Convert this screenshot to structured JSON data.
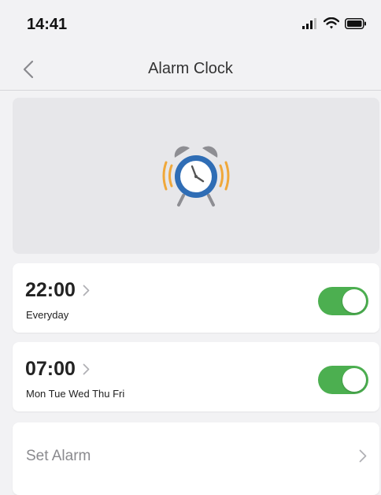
{
  "status_bar": {
    "time": "14:41",
    "icons": [
      "signal-icon",
      "wifi-icon",
      "battery-icon"
    ]
  },
  "nav": {
    "title": "Alarm Clock",
    "back_icon": "chevron-left-icon"
  },
  "hero": {
    "icon": "alarm-clock-icon",
    "colors": {
      "clock_blue": "#2f6db5",
      "bell_gray": "#8e8e93",
      "ring_orange": "#f0a83a"
    }
  },
  "alarms": [
    {
      "time": "22:00",
      "repeat": "Everyday",
      "enabled": true
    },
    {
      "time": "07:00",
      "repeat": "Mon Tue Wed Thu Fri",
      "enabled": true
    }
  ],
  "set_alarm": {
    "label": "Set Alarm"
  },
  "colors": {
    "toggle_on": "#4caf50",
    "background": "#f2f2f4",
    "card": "#ffffff"
  }
}
